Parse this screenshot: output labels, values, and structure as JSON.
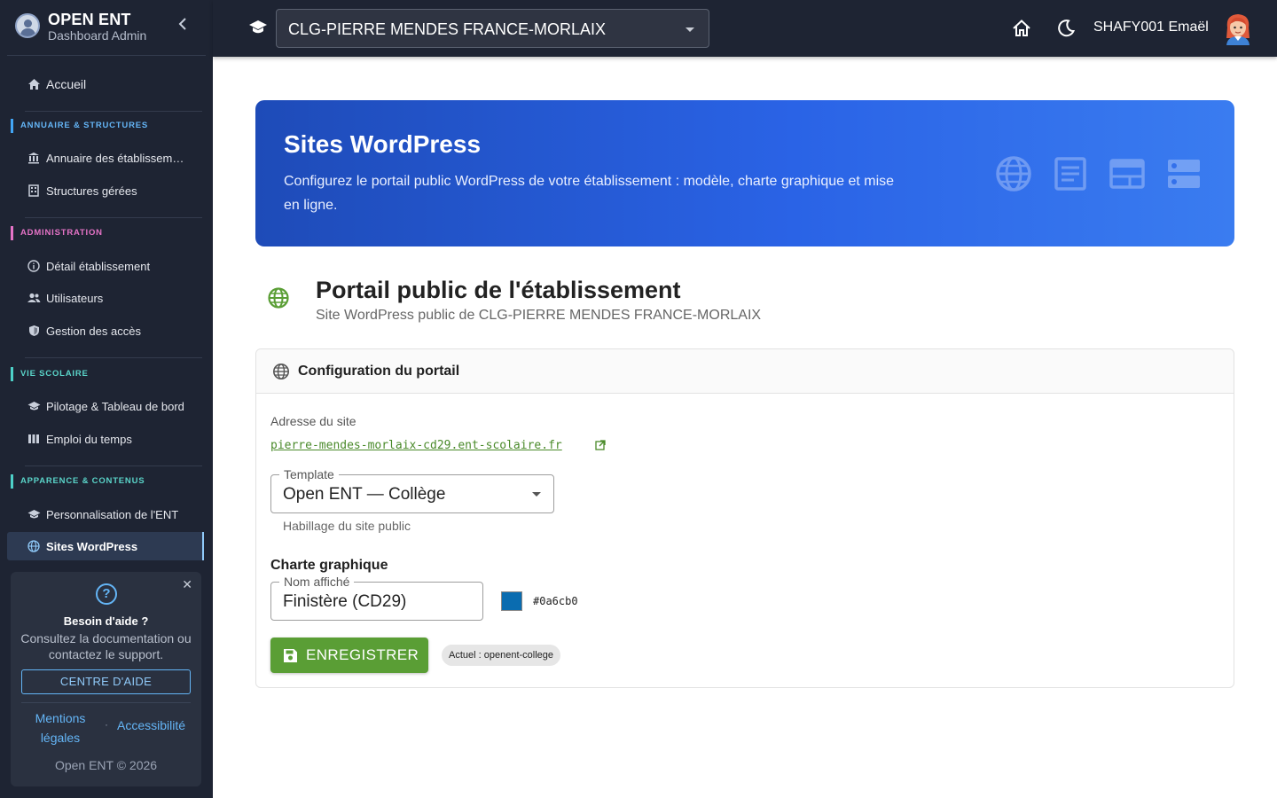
{
  "brand": {
    "title": "OPEN ENT",
    "subtitle": "Dashboard Admin"
  },
  "sidebar": {
    "home": "Accueil",
    "sections": [
      {
        "label": "ANNUAIRE & STRUCTURES",
        "color": "#42a5f5",
        "items": [
          "Annuaire des établissem…",
          "Structures gérées"
        ]
      },
      {
        "label": "ADMINISTRATION",
        "color": "#e573c7",
        "items": [
          "Détail établissement",
          "Utilisateurs",
          "Gestion des accès"
        ]
      },
      {
        "label": "VIE SCOLAIRE",
        "color": "#4dd0c8",
        "items": [
          "Pilotage & Tableau de bord",
          "Emploi du temps"
        ]
      },
      {
        "label": "APPARENCE & CONTENUS",
        "color": "#4dd0c8",
        "items": [
          "Personnalisation de l'ENT",
          "Sites WordPress"
        ]
      }
    ],
    "active_item": "Sites WordPress"
  },
  "help": {
    "title": "Besoin d'aide ?",
    "text": "Consultez la documentation ou contactez le support.",
    "button": "CENTRE D'AIDE",
    "link_legal": "Mentions légales",
    "separator": "·",
    "link_access": "Accessibilité",
    "copyright": "Open ENT © 2026"
  },
  "topbar": {
    "school": "CLG-PIERRE MENDES FRANCE-MORLAIX",
    "user": "SHAFY001 Emaël"
  },
  "hero": {
    "title": "Sites WordPress",
    "description": "Configurez le portail public WordPress de votre établissement : modèle, charte graphique et mise en ligne."
  },
  "page": {
    "title": "Portail public de l'établissement",
    "subtitle": "Site WordPress public de CLG-PIERRE MENDES FRANCE-MORLAIX"
  },
  "card": {
    "title": "Configuration du portail",
    "address_label": "Adresse du site",
    "site_url": "pierre-mendes-morlaix-cd29.ent-scolaire.fr",
    "template_label": "Template",
    "template_value": "Open ENT — Collège",
    "template_help": "Habillage du site public",
    "charte_title": "Charte graphique",
    "name_label": "Nom affiché",
    "name_value": "Finistère (CD29)",
    "color_hex": "#0a6cb0",
    "save_label": "ENREGISTRER",
    "current_chip": "Actuel : openent-college"
  },
  "colors": {
    "sidebar_bg": "#1e2433",
    "accent_green": "#5a9e35",
    "hero_gradient_start": "#1e4bb8",
    "hero_gradient_end": "#3a7cf0",
    "link_blue": "#64b5f6"
  }
}
